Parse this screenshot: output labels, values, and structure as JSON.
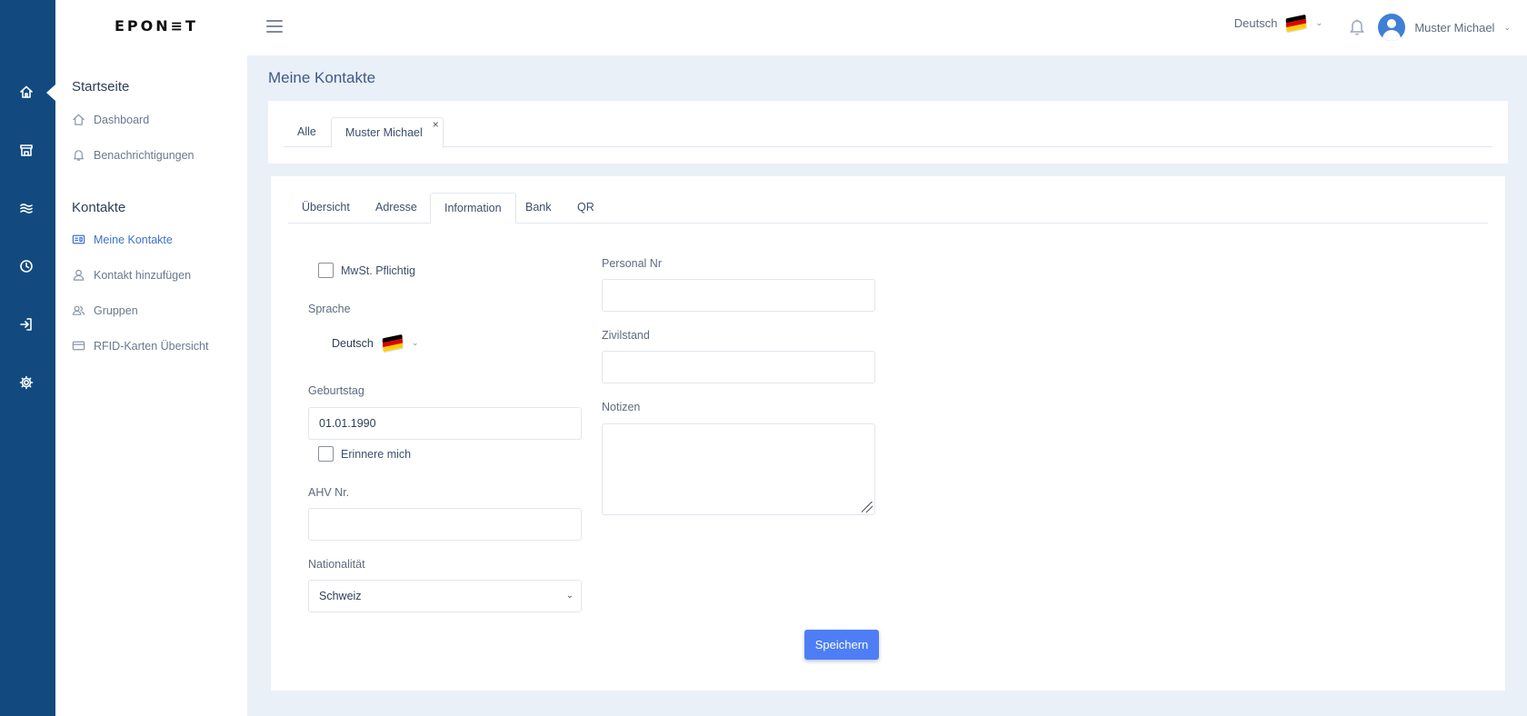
{
  "app": {
    "logo": "EPON≡T"
  },
  "header": {
    "language": "Deutsch",
    "user_name": "Muster Michael",
    "flag_colors": [
      "#000000",
      "#dd0000",
      "#ffce00"
    ]
  },
  "rail": {
    "icons": [
      "home-icon",
      "store-icon",
      "waves-icon",
      "clock-icon",
      "login-icon",
      "gear-icon"
    ]
  },
  "sidebar": {
    "sections": [
      {
        "title": "Startseite",
        "items": [
          {
            "label": "Dashboard",
            "icon": "home-icon"
          },
          {
            "label": "Benachrichtigungen",
            "icon": "bell-icon"
          }
        ]
      },
      {
        "title": "Kontakte",
        "items": [
          {
            "label": "Meine Kontakte",
            "icon": "id-card-icon",
            "active": true
          },
          {
            "label": "Kontakt hinzufügen",
            "icon": "user-icon"
          },
          {
            "label": "Gruppen",
            "icon": "users-icon"
          },
          {
            "label": "RFID-Karten Übersicht",
            "icon": "card-icon"
          }
        ]
      }
    ]
  },
  "page": {
    "title": "Meine Kontakte"
  },
  "contact_tabs": [
    {
      "label": "Alle",
      "active": false
    },
    {
      "label": "Muster Michael",
      "active": true,
      "close": "×"
    }
  ],
  "detail_tabs": [
    {
      "label": "Übersicht",
      "active": false
    },
    {
      "label": "Adresse",
      "active": false
    },
    {
      "label": "Information",
      "active": true
    },
    {
      "label": "Bank",
      "active": false
    },
    {
      "label": "QR",
      "active": false
    }
  ],
  "form": {
    "vat_label": "MwSt. Pflichtig",
    "language_label": "Sprache",
    "language_value": "Deutsch",
    "birthday_label": "Geburtstag",
    "birthday_value": "01.01.1990",
    "remind_label": "Erinnere mich",
    "ahv_label": "AHV Nr.",
    "ahv_value": "",
    "nationality_label": "Nationalität",
    "nationality_value": "Schweiz",
    "personal_label": "Personal Nr",
    "personal_value": "",
    "civil_label": "Zivilstand",
    "civil_value": "",
    "notes_label": "Notizen",
    "notes_value": "",
    "save_label": "Speichern"
  },
  "colors": {
    "rail": "#124a80",
    "accent": "#4d7ef5",
    "active_link": "#3f72c9"
  }
}
